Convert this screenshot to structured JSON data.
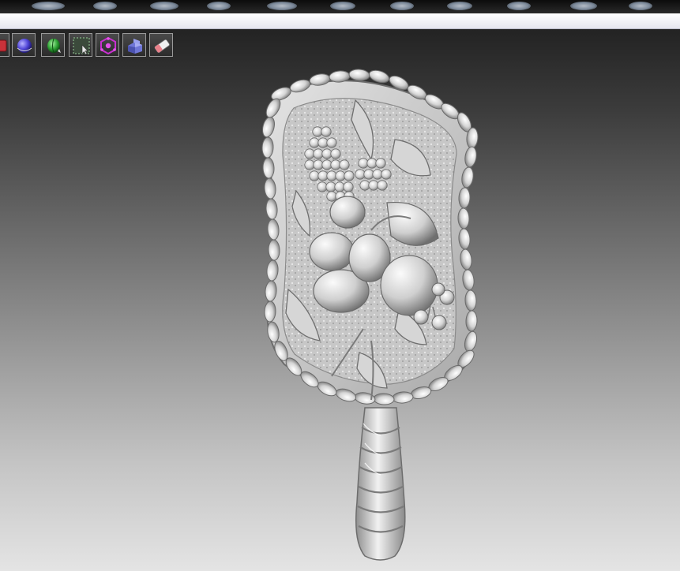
{
  "window": {
    "title": ""
  },
  "toolbar": {
    "tools": [
      {
        "icon": "red-cube-icon"
      },
      {
        "icon": "sphere-icon"
      },
      {
        "icon": "green-orb-icon"
      },
      {
        "icon": "select-region-icon"
      },
      {
        "icon": "transform-gizmo-icon"
      },
      {
        "icon": "extrude-block-icon"
      },
      {
        "icon": "eraser-icon"
      }
    ]
  },
  "viewport": {
    "model": "carved-mirror-relief",
    "background_top": "#232323",
    "background_bottom": "#e4e4e4",
    "model_color": "#d8d8d8"
  }
}
